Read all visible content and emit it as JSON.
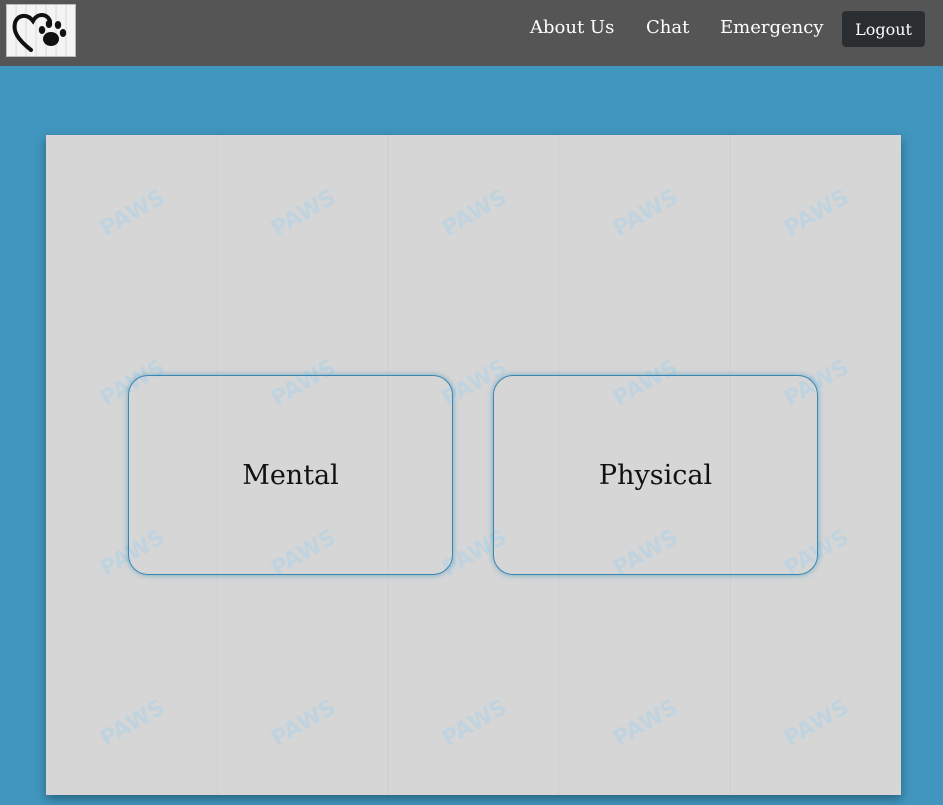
{
  "nav": {
    "logo_icon": "heart-paw-logo",
    "links": [
      "About Us",
      "Chat",
      "Emergency"
    ],
    "logout_label": "Logout"
  },
  "main": {
    "watermark_text": "PAWS",
    "cards": [
      "Mental",
      "Physical"
    ]
  },
  "colors": {
    "page_background": "#4096bf",
    "navbar": "#555555",
    "logout_button": "#2b2e31",
    "panel": "#d6d6d6",
    "card_border": "#3a86b0"
  }
}
